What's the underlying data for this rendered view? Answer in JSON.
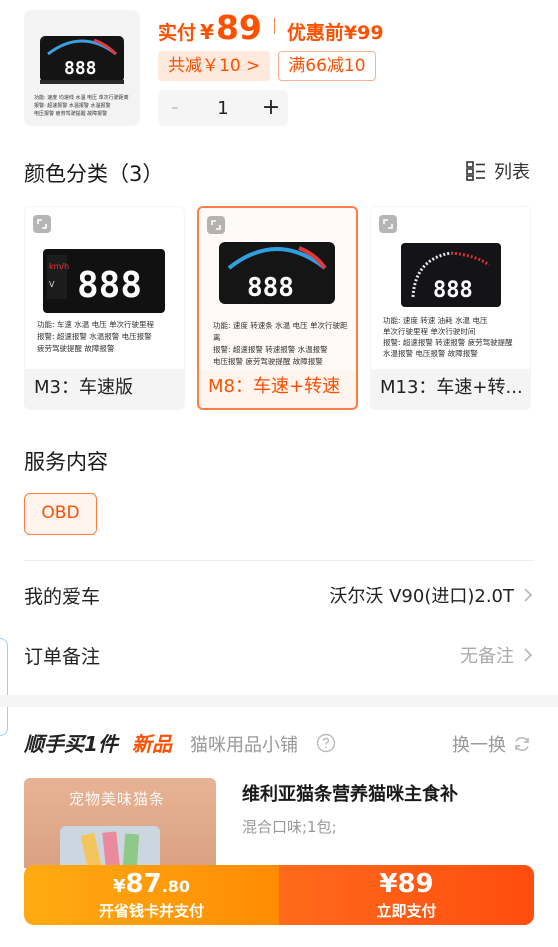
{
  "header": {
    "price_label": "实付",
    "currency": "¥",
    "price_value": "89",
    "original_price_label": "优惠前¥99",
    "discount_tag": "共减￥10 >",
    "coupon_tag": "满66减10",
    "quantity": "1",
    "qty_minus": "-",
    "qty_plus": "+",
    "thumbnail_lines": [
      "功能: 速度 均速线 水温 电压 单次行驶距离",
      "报警: 超速报警 水温报警 水温报警",
      "电压报警 疲劳驾驶提醒 故障报警"
    ]
  },
  "color_section": {
    "title": "颜色分类（3）",
    "view_toggle": "列表",
    "options": [
      {
        "label": "M3：车速版",
        "selected": false,
        "display": "888",
        "spec_lines": [
          "功能: 车速 水温 电压 单次行驶里程",
          "报警: 超速报警 水温报警 电压报警",
          "疲劳驾驶提醒 故障报警"
        ]
      },
      {
        "label": "M8：车速+转速",
        "selected": true,
        "display": "888",
        "spec_lines": [
          "功能: 速度 转速条 水温 电压 单次行驶距离",
          "报警: 超速报警 转速报警 水温报警",
          "电压报警 疲劳驾驶提醒 故障报警"
        ]
      },
      {
        "label": "M13：车速+转...",
        "selected": false,
        "display": "888",
        "spec_lines": [
          "功能: 速度 转速 油耗 水温 电压",
          "单次行驶里程 单次行驶时间",
          "报警: 超速报警 转速报警 疲劳驾驶提醒",
          "水温报警 电压报警 故障报警"
        ]
      }
    ]
  },
  "service": {
    "title": "服务内容",
    "option": "OBD"
  },
  "rows": {
    "car_label": "我的爱车",
    "car_value": "沃尔沃 V90(进口)2.0T",
    "note_label": "订单备注",
    "note_value": "无备注"
  },
  "bundle": {
    "title": "顺手买1件",
    "new_tag": "新品",
    "shop": "猫咪用品小铺",
    "swap": "换一换",
    "product_image_text": "宠物美味猫条",
    "product_name": "维利亚猫条营养猫咪主食补",
    "product_spec": "混合口味;1包;"
  },
  "bottom_bar": {
    "card_price_yen": "¥",
    "card_price_int": "87",
    "card_price_dec": ".80",
    "card_button": "开省钱卡并支付",
    "buy_price": "¥89",
    "buy_button": "立即支付"
  },
  "colors": {
    "accent": "#ff5000",
    "accent_border": "#ff7d45",
    "card_btn": "#ff9a0b",
    "buy_btn": "#ff5a14"
  }
}
